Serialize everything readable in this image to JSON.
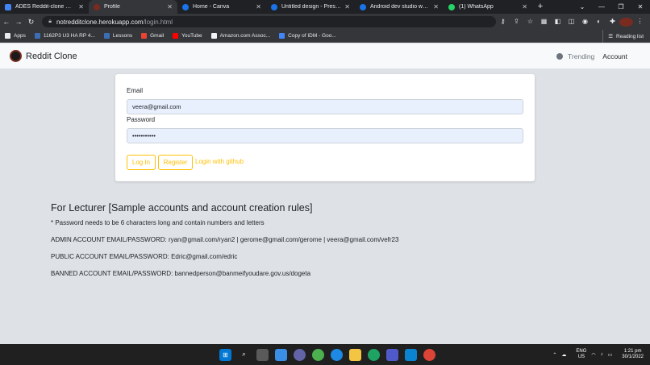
{
  "browser": {
    "tabs": [
      {
        "label": "ADES Reddit-clone CA2 - C",
        "color": "#4285f4",
        "active": false
      },
      {
        "label": "Profile",
        "color": "#7a2b1f",
        "active": true
      },
      {
        "label": "Home - Canva",
        "color": "#1a73e8",
        "active": false
      },
      {
        "label": "Untitled design - Presentati",
        "color": "#1a73e8",
        "active": false
      },
      {
        "label": "Android dev studio website",
        "color": "#1a73e8",
        "active": false
      },
      {
        "label": "(1) WhatsApp",
        "color": "#25d366",
        "active": false
      }
    ],
    "url_host": "notredditclone.herokuapp.com",
    "url_path": "/login.html",
    "bookmarks": [
      {
        "label": "Apps",
        "color": "#e8eaed"
      },
      {
        "label": "1162P3 U3 HA RP 4...",
        "color": "#3c6eb4"
      },
      {
        "label": "Lessons",
        "color": "#3c6eb4"
      },
      {
        "label": "Gmail",
        "color": "#ea4335"
      },
      {
        "label": "YouTube",
        "color": "#ff0000"
      },
      {
        "label": "Amazon.com Assoc...",
        "color": "#f1f3f4"
      },
      {
        "label": "Copy of IDM - Goo...",
        "color": "#4285f4"
      }
    ],
    "reading_list": "Reading list"
  },
  "navbar": {
    "brand": "Reddit Clone",
    "trending": "Trending",
    "account": "Account"
  },
  "login": {
    "email_label": "Email",
    "email_value": "veera@gmail.com",
    "password_label": "Password",
    "password_value": "•••••••••••",
    "login_button": "Log In",
    "register_button": "Register",
    "github_link": "Login with github"
  },
  "info": {
    "heading": "For Lecturer [Sample accounts and account creation rules]",
    "rule": "* Password needs to be 6 characters long and contain numbers and letters",
    "admin": "ADMIN ACCOUNT EMAIL/PASSWORD: ryan@gmail.com/ryan2 | gerome@gmail.com/gerome | veera@gmail.com/vefr23",
    "public": "PUBLIC ACCOUNT EMAIL/PASSWORD: Edric@gmail.com/edric",
    "banned": "BANNED ACCOUNT EMAIL/PASSWORD: bannedperson@banmeifyoudare.gov.us/dogeta"
  },
  "taskbar": {
    "lang_top": "ENG",
    "lang_bottom": "US",
    "time": "1:21 pm",
    "date": "30/1/2022"
  }
}
